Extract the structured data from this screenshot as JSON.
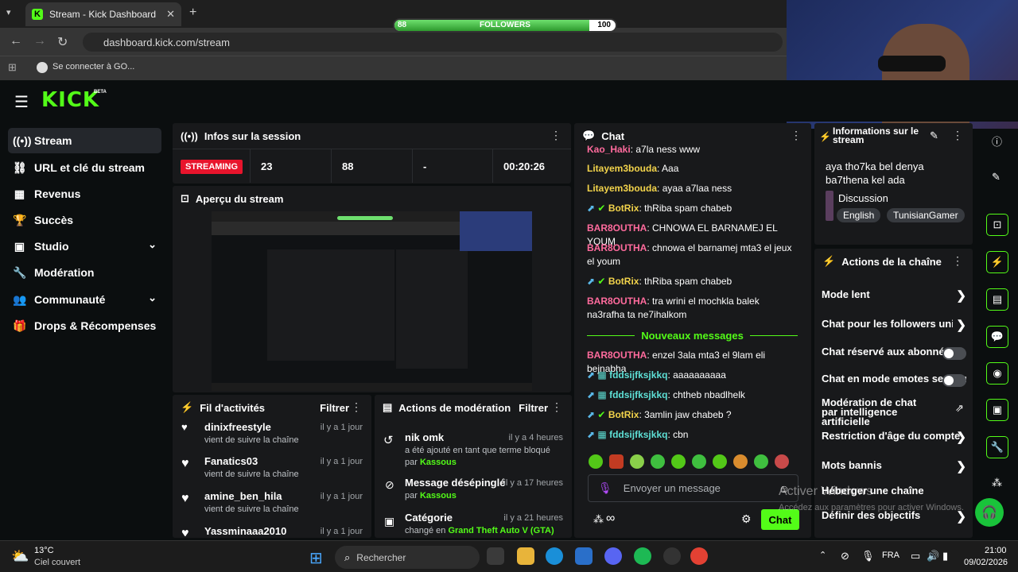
{
  "browser": {
    "tab_title": "Stream - Kick Dashboard",
    "url": "dashboard.kick.com/stream",
    "bookmark": "Se connecter à GO..."
  },
  "followers": {
    "current": "88",
    "label": "FOLLOWERS",
    "goal": "100",
    "progress": 0.88
  },
  "logo": {
    "text": "KICK",
    "badge": "BETA"
  },
  "sidebar": {
    "items": [
      {
        "label": "Stream",
        "icon": "broadcast-icon"
      },
      {
        "label": "URL et clé du stream",
        "icon": "link-icon"
      },
      {
        "label": "Revenus",
        "icon": "revenue-icon"
      },
      {
        "label": "Succès",
        "icon": "trophy-icon"
      },
      {
        "label": "Studio",
        "icon": "studio-icon"
      },
      {
        "label": "Modération",
        "icon": "wrench-icon"
      },
      {
        "label": "Communauté",
        "icon": "community-icon"
      },
      {
        "label": "Drops & Récompenses",
        "icon": "gift-icon"
      }
    ]
  },
  "session": {
    "title": "Infos sur la session",
    "status": "STREAMING",
    "viewers": "23",
    "followers": "88",
    "subs": "-",
    "duration": "00:20:26"
  },
  "preview": {
    "title": "Aperçu du stream"
  },
  "activity": {
    "title": "Fil d'activités",
    "filter": "Filtrer",
    "items": [
      {
        "name": "dinixfreestyle",
        "sub": "vient de suivre la chaîne",
        "time": "il y a 1 jour"
      },
      {
        "name": "Fanatics03",
        "sub": "vient de suivre la chaîne",
        "time": "il y a 1 jour"
      },
      {
        "name": "amine_ben_hila",
        "sub": "vient de suivre la chaîne",
        "time": "il y a 1 jour"
      },
      {
        "name": "Yassminaaa2010",
        "sub": "",
        "time": "il y a 1 jour"
      }
    ]
  },
  "moderation": {
    "title": "Actions de modération",
    "filter": "Filtrer",
    "items": [
      {
        "title": "nik omk",
        "sub": "a été ajouté en tant que terme bloqué",
        "by_prefix": "par",
        "by": "Kassous",
        "time": "il y a 4 heures"
      },
      {
        "title": "Message désépinglé",
        "sub": "",
        "by_prefix": "par",
        "by": "Kassous",
        "time": "il y a 17 heures"
      },
      {
        "title": "Catégorie",
        "sub": "changé en",
        "by_prefix": "par",
        "by": "Grand Theft Auto V (GTA)",
        "time": "il y a 21 heures"
      }
    ]
  },
  "chat": {
    "title": "Chat",
    "new_messages": "Nouveaux messages",
    "placeholder": "Envoyer un message",
    "send": "Chat",
    "messages": [
      {
        "user": "Kao_Haki",
        "text": "a7la ness www",
        "color": "#ff6b9d"
      },
      {
        "user": "Litayem3bouda",
        "text": "Aaa",
        "color": "#f2d34b"
      },
      {
        "user": "Litayem3bouda",
        "text": "ayaa a7laa ness",
        "color": "#f2d34b"
      },
      {
        "user": "BotRix",
        "text": "thRiba spam chabeb",
        "color": "#f2d34b"
      },
      {
        "user": "BAR8OUTHA",
        "text": "CHNOWA EL BARNAMEJ EL YOUM",
        "color": "#ff6b9d"
      },
      {
        "user": "BAR8OUTHA",
        "text": "chnowa el barnamej mta3 el jeux el youm",
        "color": "#ff6b9d"
      },
      {
        "user": "BotRix",
        "text": "thRiba spam chabeb",
        "color": "#f2d34b"
      },
      {
        "user": "BAR8OUTHA",
        "text": "tra wrini el mochkla balek na3rafha ta ne7ihalkom",
        "color": "#ff6b9d"
      },
      {
        "user": "BAR8OUTHA",
        "text": "enzel 3ala mta3 el 9lam eli bejnabha",
        "color": "#ff6b9d"
      },
      {
        "user": "fddsijfksjkkq",
        "text": "aaaaaaaaaa",
        "color": "#5ee0d6"
      },
      {
        "user": "fddsijfksjkkq",
        "text": "chtheb nbadlhelk",
        "color": "#5ee0d6"
      },
      {
        "user": "BotRix",
        "text": "3amlin jaw chabeb ?",
        "color": "#f2d34b"
      },
      {
        "user": "fddsijfksjkkq",
        "text": "cbn",
        "color": "#5ee0d6"
      }
    ]
  },
  "stream_info": {
    "title": "Informations sur le stream",
    "stream_title": "aya tho7ka bel denya ba7thena kel ada",
    "category": "Discussion",
    "tags": [
      "English",
      "TunisianGamer"
    ]
  },
  "channel_actions": {
    "title": "Actions de la chaîne",
    "items": [
      "Mode lent",
      "Chat pour les followers uniquement",
      "Chat réservé aux abonnés",
      "Chat en mode emotes seulement",
      "Modération de chat par intelligence artificielle",
      "Restriction d'âge du compte",
      "Mots bannis",
      "Héberger une chaîne",
      "Définir des objectifs"
    ]
  },
  "watermark": {
    "line1": "Activer Windows",
    "line2": "Accédez aux paramètres pour activer Windows."
  },
  "taskbar": {
    "weather_temp": "13°C",
    "weather_desc": "Ciel couvert",
    "search": "Rechercher",
    "lang": "FRA",
    "time": "21:00",
    "date": "09/02/2026"
  }
}
